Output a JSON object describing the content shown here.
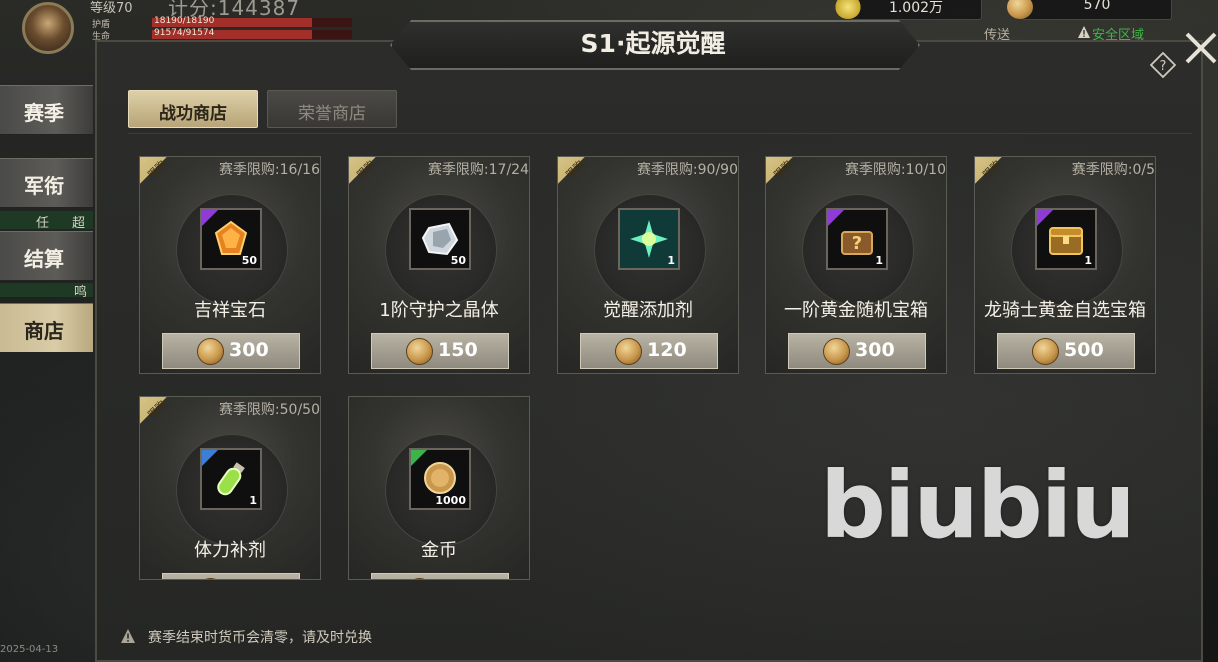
{
  "hud": {
    "level": "等级70",
    "score": "计分:144387",
    "bars": [
      {
        "label": "护盾",
        "value": "18190/18190",
        "color": "#b3352f"
      },
      {
        "label": "生命",
        "value": "91574/91574",
        "color": "#b3352f"
      }
    ],
    "resource_gold": "1.002万",
    "resource_coin": "570",
    "teleport": "传送",
    "safe_zone": "安全区域"
  },
  "sidebar": {
    "items": [
      {
        "label": "赛季"
      },
      {
        "label": "军衔"
      },
      {
        "label": "结算"
      },
      {
        "label": "商店"
      }
    ],
    "strip1": [
      "任",
      "超"
    ],
    "strip2": [
      "鸣"
    ],
    "date": "2025-04-13"
  },
  "panel": {
    "title": "S1·起源觉醒",
    "tabs": [
      {
        "label": "战功商店",
        "active": true
      },
      {
        "label": "荣誉商店",
        "active": false
      }
    ],
    "ribbon_text": "限购",
    "footer_note": "赛季结束时货币会清零，请及时兑换",
    "watermark": "biubiu"
  },
  "items": [
    {
      "name": "吉祥宝石",
      "limit": "赛季限购:16/16",
      "qty": "50",
      "price": "300",
      "rarity_color": "#8f3bd6",
      "icon": "gem-icon"
    },
    {
      "name": "1阶守护之晶体",
      "limit": "赛季限购:17/24",
      "qty": "50",
      "price": "150",
      "rarity_color": "#8f3bd6",
      "icon": "crystal-icon"
    },
    {
      "name": "觉醒添加剂",
      "limit": "赛季限购:90/90",
      "qty": "1",
      "price": "120",
      "rarity_color": "#8f3bd6",
      "icon": "spark-icon"
    },
    {
      "name": "一阶黄金随机宝箱",
      "limit": "赛季限购:10/10",
      "qty": "1",
      "price": "300",
      "rarity_color": "#8f3bd6",
      "icon": "mystery-chest-icon"
    },
    {
      "name": "龙骑士黄金自选宝箱",
      "limit": "赛季限购:0/5",
      "qty": "1",
      "price": "500",
      "rarity_color": "#8f3bd6",
      "icon": "golden-chest-icon"
    },
    {
      "name": "体力补剂",
      "limit": "赛季限购:50/50",
      "qty": "1",
      "price": "",
      "rarity_color": "#3b7fd6",
      "icon": "potion-icon"
    },
    {
      "name": "金币",
      "limit": "",
      "qty": "1000",
      "price": "",
      "rarity_color": "#3bb54a",
      "icon": "gold-coin-icon"
    }
  ]
}
